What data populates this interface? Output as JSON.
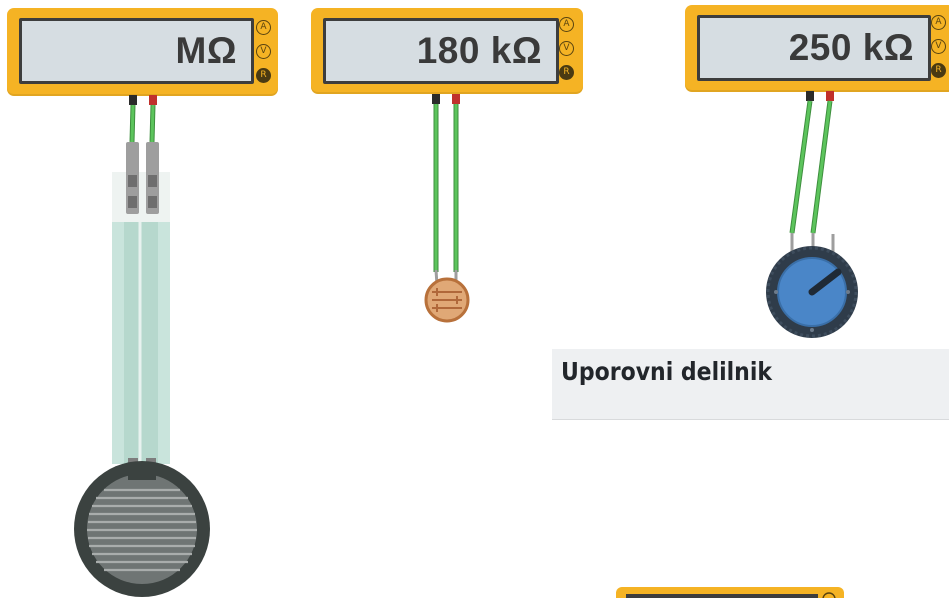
{
  "meters": [
    {
      "id": "meter-1",
      "display": "MΩ",
      "buttons": [
        "A",
        "V",
        "R"
      ],
      "selected": "R"
    },
    {
      "id": "meter-2",
      "display": "180 kΩ",
      "buttons": [
        "A",
        "V",
        "R"
      ],
      "selected": "R"
    },
    {
      "id": "meter-3",
      "display": "250 kΩ",
      "buttons": [
        "A",
        "V",
        "R"
      ],
      "selected": "R"
    }
  ],
  "components": [
    "force-sensor",
    "photoresistor",
    "potentiometer"
  ],
  "section": {
    "title": "Uporovni delilnik"
  },
  "colors": {
    "meter_body": "#f5b324",
    "screen": "#d6dde2",
    "wire": "#4caf50",
    "probe_red": "#c0302c",
    "probe_black": "#2b2b2b",
    "knob": "#4a86c8"
  }
}
